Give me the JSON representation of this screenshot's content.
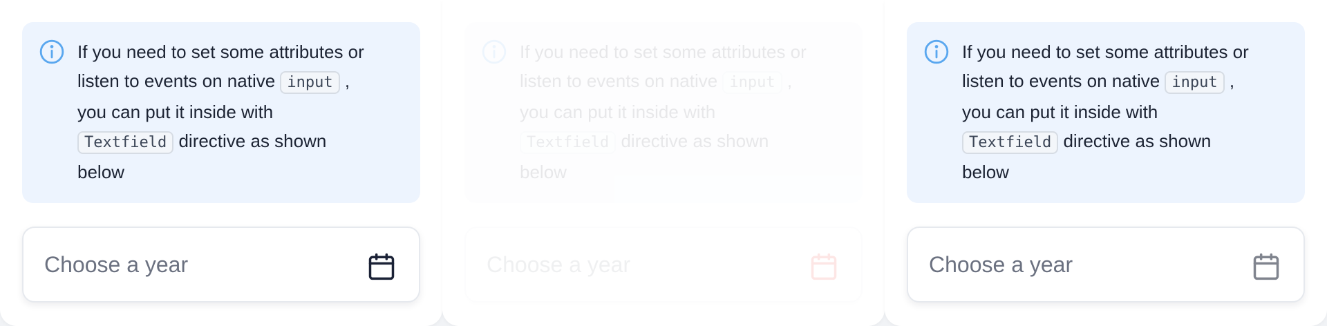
{
  "note": {
    "line1": "If you need to set some attributes or",
    "line2_prefix": "listen to events on native",
    "code_input": "input",
    "line2_suffix": ",",
    "line3": "you can put it inside with",
    "code_textfield": "Textfield",
    "line4_suffix": "directive as shown",
    "line5": "below"
  },
  "field": {
    "placeholder": "Choose a year"
  },
  "icons": {
    "info": "info-circle-icon",
    "calendar": "calendar-icon"
  },
  "colors": {
    "info_icon": "#5aa7ef",
    "note_background": "#edf4fe",
    "calendar_default": "#1b2236",
    "calendar_error": "#ef1b0e",
    "calendar_disabled": "#80848e"
  }
}
